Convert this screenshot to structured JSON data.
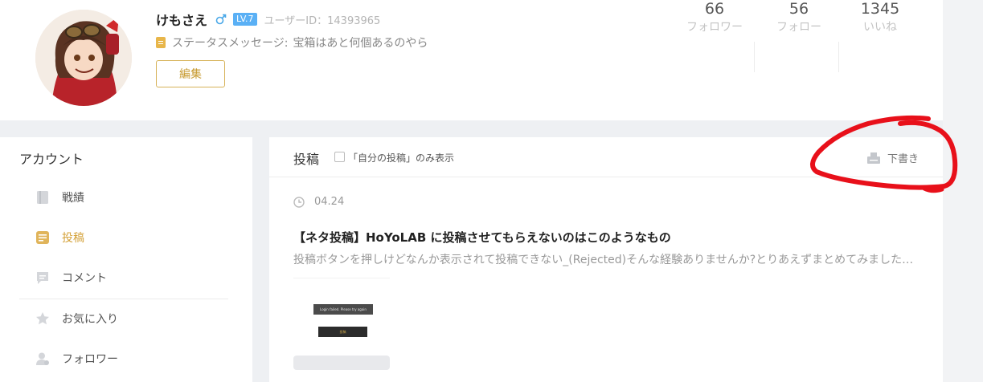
{
  "profile": {
    "username": "けもさえ",
    "level": "LV.7",
    "uid": "ユーザーID：14393965",
    "status_label": "ステータスメッセージ:",
    "status_message": "宝箱はあと何個あるのやら",
    "edit_label": "編集",
    "stats": [
      {
        "value": "66",
        "label": "フォロワー"
      },
      {
        "value": "56",
        "label": "フォロー"
      },
      {
        "value": "1345",
        "label": "いいね"
      }
    ]
  },
  "sidebar": {
    "title": "アカウント",
    "items": [
      {
        "label": "戦績",
        "icon": "book-icon",
        "active": false
      },
      {
        "label": "投稿",
        "icon": "post-icon",
        "active": true
      },
      {
        "label": "コメント",
        "icon": "comment-icon",
        "active": false
      },
      {
        "label": "お気に入り",
        "icon": "star-icon",
        "active": false
      },
      {
        "label": "フォロワー",
        "icon": "user-icon",
        "active": false
      }
    ]
  },
  "main": {
    "title": "投稿",
    "checkbox_label": "「自分の投稿」のみ表示",
    "draft_label": "下書き",
    "posts": [
      {
        "date": "04.24",
        "title": "【ネタ投稿】HoYoLAB に投稿させてもらえないのはこのようなもの",
        "snippet": "投稿ボタンを押しけどなんか表示されて投稿できない_(Rejected)そんな経験ありませんか?とりあえずまとめてみました…",
        "thumb_text1": "Login failed. Please try again",
        "thumb_text2": "投稿"
      }
    ]
  },
  "colors": {
    "accent": "#d4a23a",
    "level_badge": "#5ab0f5",
    "annotation": "#e8101a"
  }
}
